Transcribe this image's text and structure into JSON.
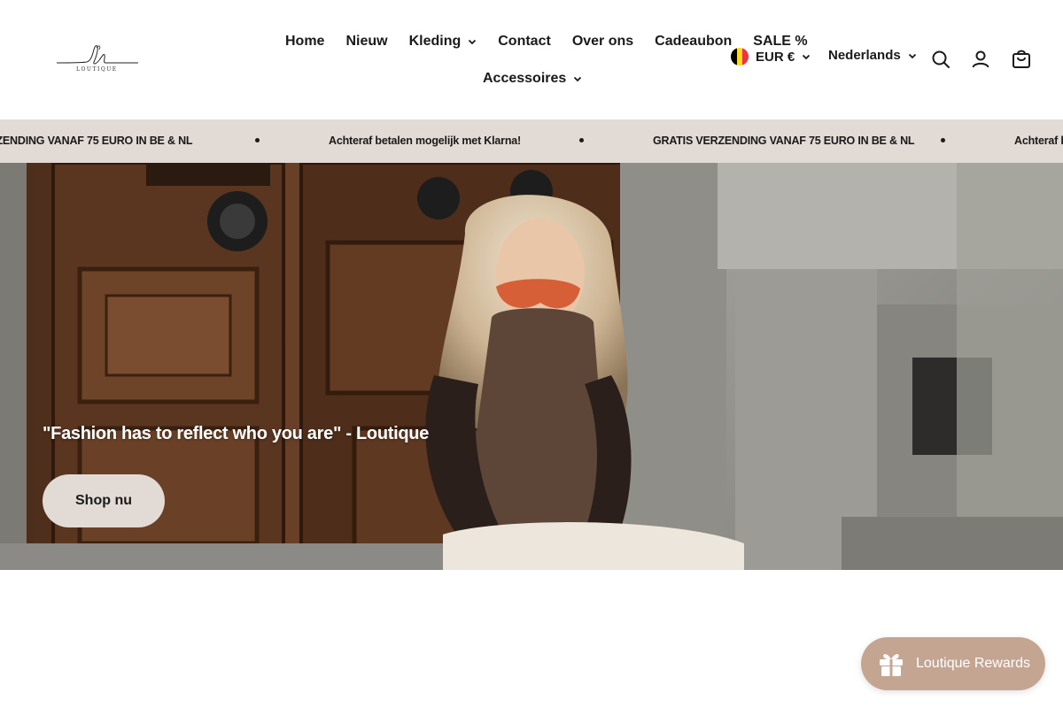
{
  "brand": {
    "logo_text": "LOUTIQUE"
  },
  "nav": {
    "items": [
      {
        "label": "Home",
        "dropdown": false
      },
      {
        "label": "Nieuw",
        "dropdown": false
      },
      {
        "label": "Kleding",
        "dropdown": true
      },
      {
        "label": "Contact",
        "dropdown": false
      },
      {
        "label": "Over ons",
        "dropdown": false
      },
      {
        "label": "Cadeaubon",
        "dropdown": false
      },
      {
        "label": "SALE %",
        "dropdown": false
      },
      {
        "label": "Accessoires",
        "dropdown": true
      }
    ]
  },
  "locale": {
    "currency": "EUR €",
    "language": "Nederlands",
    "flag_colors": [
      "#000000",
      "#fdda24",
      "#ef3340"
    ]
  },
  "header_icons": [
    "search-icon",
    "account-icon",
    "cart-icon"
  ],
  "announcement": {
    "messages": [
      "GRATIS VERZENDING VANAF 75 EURO IN BE & NL",
      "Achteraf betalen mogelijk met Klarna!",
      "GRATIS VERZENDING VANAF 75 EURO IN BE & NL",
      "Achteraf betalen mogelijk met Klarna!"
    ]
  },
  "hero": {
    "quote": "\"Fashion has to reflect who you are\" - Loutique",
    "button_label": "Shop nu"
  },
  "rewards": {
    "label": "Loutique Rewards",
    "icon": "gift-icon"
  },
  "colors": {
    "accent": "#e2dad5",
    "rewards": "#c4a591",
    "text": "#1a1a1a"
  }
}
